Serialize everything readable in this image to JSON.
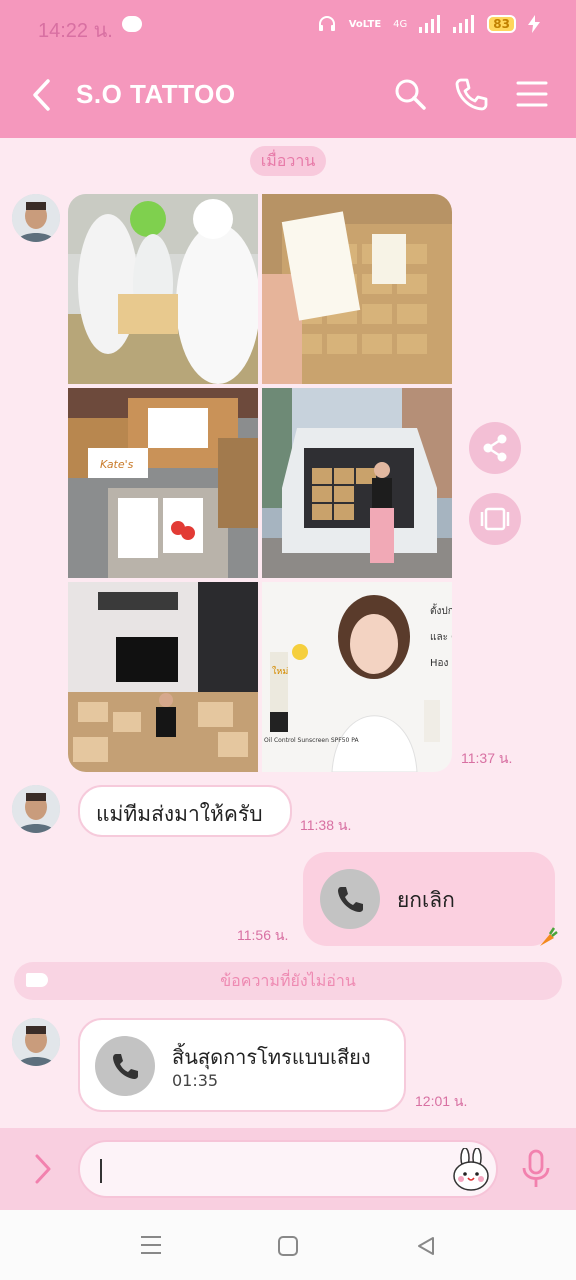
{
  "status_bar": {
    "time": "14:22 น.",
    "network_1": "VoLTE",
    "network_2": "4G",
    "battery": "83"
  },
  "header": {
    "title": "S.O TATTOO",
    "icons": [
      "back-icon",
      "search-icon",
      "phone-icon",
      "menu-icon"
    ]
  },
  "date_separator": "เมื่อวาน",
  "messages": [
    {
      "type": "photo_album",
      "side": "left",
      "photo_count": 6,
      "time": "11:37 น."
    },
    {
      "type": "text",
      "side": "left",
      "text": "แม่ทีมส่งมาให้ครับ",
      "time": "11:38 น."
    },
    {
      "type": "call",
      "side": "right",
      "label": "ยกเลิก",
      "time": "11:56 น."
    },
    {
      "type": "call",
      "side": "left",
      "label": "สิ้นสุดการโทรแบบเสียง",
      "duration": "01:35",
      "time": "12:01 น."
    }
  ],
  "unread_label": "ข้อความที่ยังไม่อ่าน",
  "photo_overlay_texts": {
    "box_brand": "Kate's",
    "ad_line_1": "ตั้งปกป้",
    "ad_line_2": "และ ดูแล",
    "ad_line_3": "Hอง",
    "ad_product": "Oil Control  Sunscreen SPF50 PA",
    "ad_badge": "ใหม่"
  },
  "input": {
    "placeholder": ""
  },
  "colors": {
    "header": "#f598bd",
    "background": "#fde9f1",
    "accent": "#e77aa8"
  }
}
